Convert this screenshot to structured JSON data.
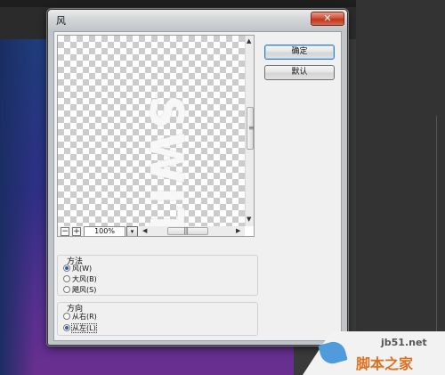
{
  "dialog": {
    "title": "风",
    "close_label": "✕"
  },
  "preview": {
    "zoom_value": "100%",
    "zoom_minus": "−",
    "zoom_plus": "+",
    "dropdown_glyph": "▾"
  },
  "buttons": {
    "ok_label": "确定",
    "default_label": "默认"
  },
  "method": {
    "label": "方法",
    "options": [
      {
        "label": "风(W)",
        "selected": true
      },
      {
        "label": "大风(B)",
        "selected": false
      },
      {
        "label": "飓风(S)",
        "selected": false
      }
    ]
  },
  "direction": {
    "label": "方向",
    "options": [
      {
        "label": "从右(R)",
        "selected": false
      },
      {
        "label": "从左(L)",
        "selected": true
      }
    ]
  },
  "watermark": {
    "site": "jb51.net",
    "name": "脚本之家"
  },
  "icons": {
    "scroll_up": "▲",
    "scroll_down": "▼",
    "scroll_left": "◀",
    "scroll_right": "▶",
    "grip_vertical": "≡",
    "grip_horizontal": "|||"
  }
}
